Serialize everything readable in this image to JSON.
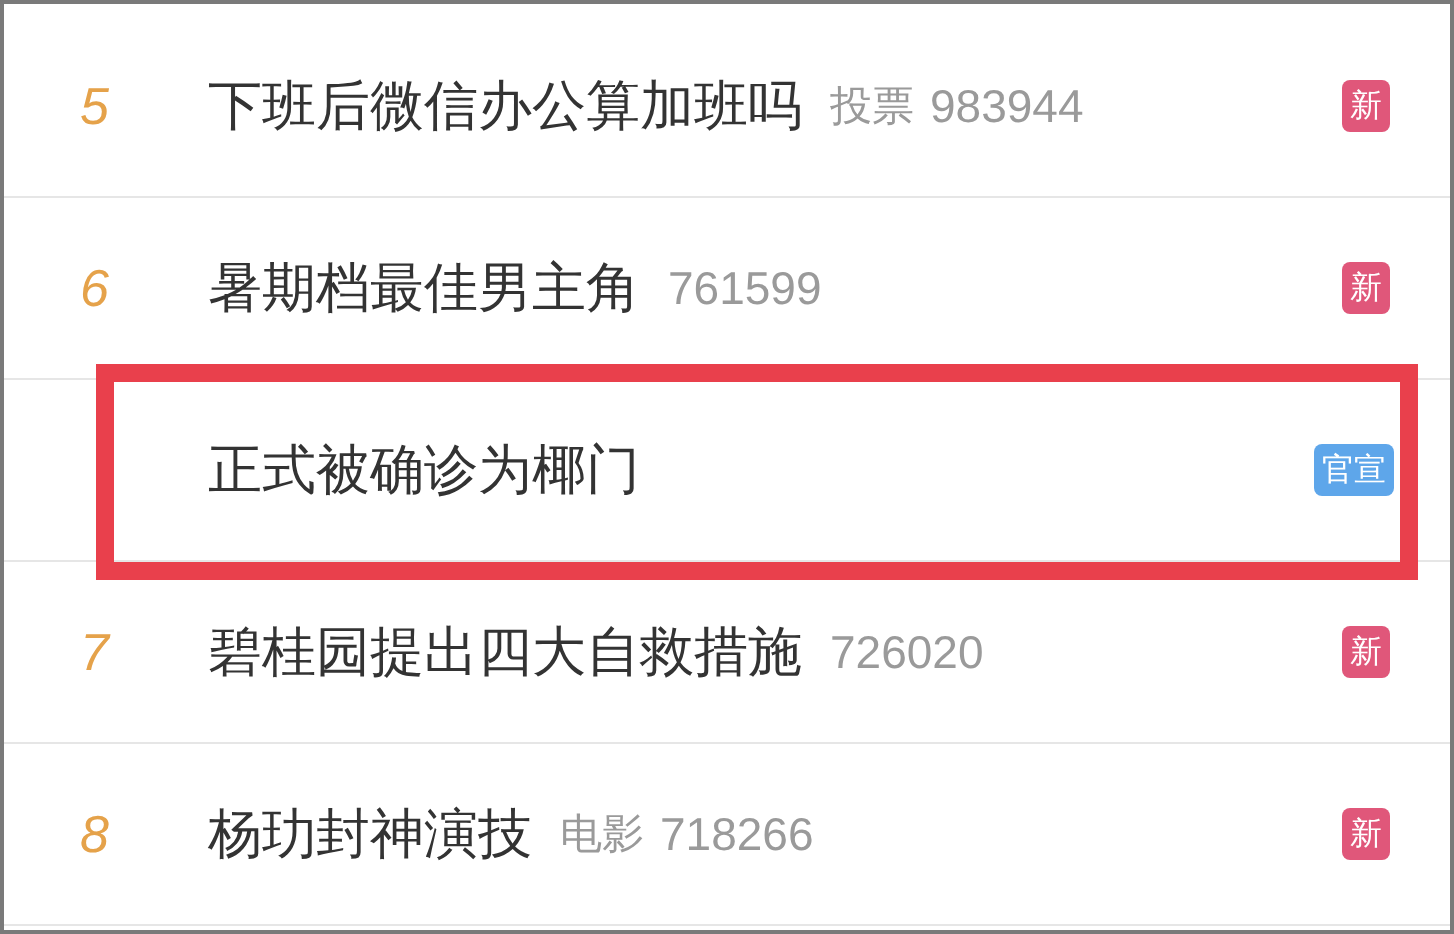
{
  "items": [
    {
      "rank": "5",
      "title": "下班后微信办公算加班吗",
      "category": "投票",
      "count": "983944",
      "badge": {
        "kind": "new",
        "label": "新"
      },
      "highlighted": false
    },
    {
      "rank": "6",
      "title": "暑期档最佳男主角",
      "count": "761599",
      "badge": {
        "kind": "new",
        "label": "新"
      },
      "highlighted": false
    },
    {
      "title": "正式被确诊为椰门",
      "badge": {
        "kind": "official",
        "label": "官宣"
      },
      "highlighted": true
    },
    {
      "rank": "7",
      "title": "碧桂园提出四大自救措施",
      "count": "726020",
      "badge": {
        "kind": "new",
        "label": "新"
      },
      "highlighted": false
    },
    {
      "rank": "8",
      "title": "杨玏封神演技",
      "category": "电影",
      "count": "718266",
      "badge": {
        "kind": "new",
        "label": "新"
      },
      "highlighted": false
    }
  ]
}
